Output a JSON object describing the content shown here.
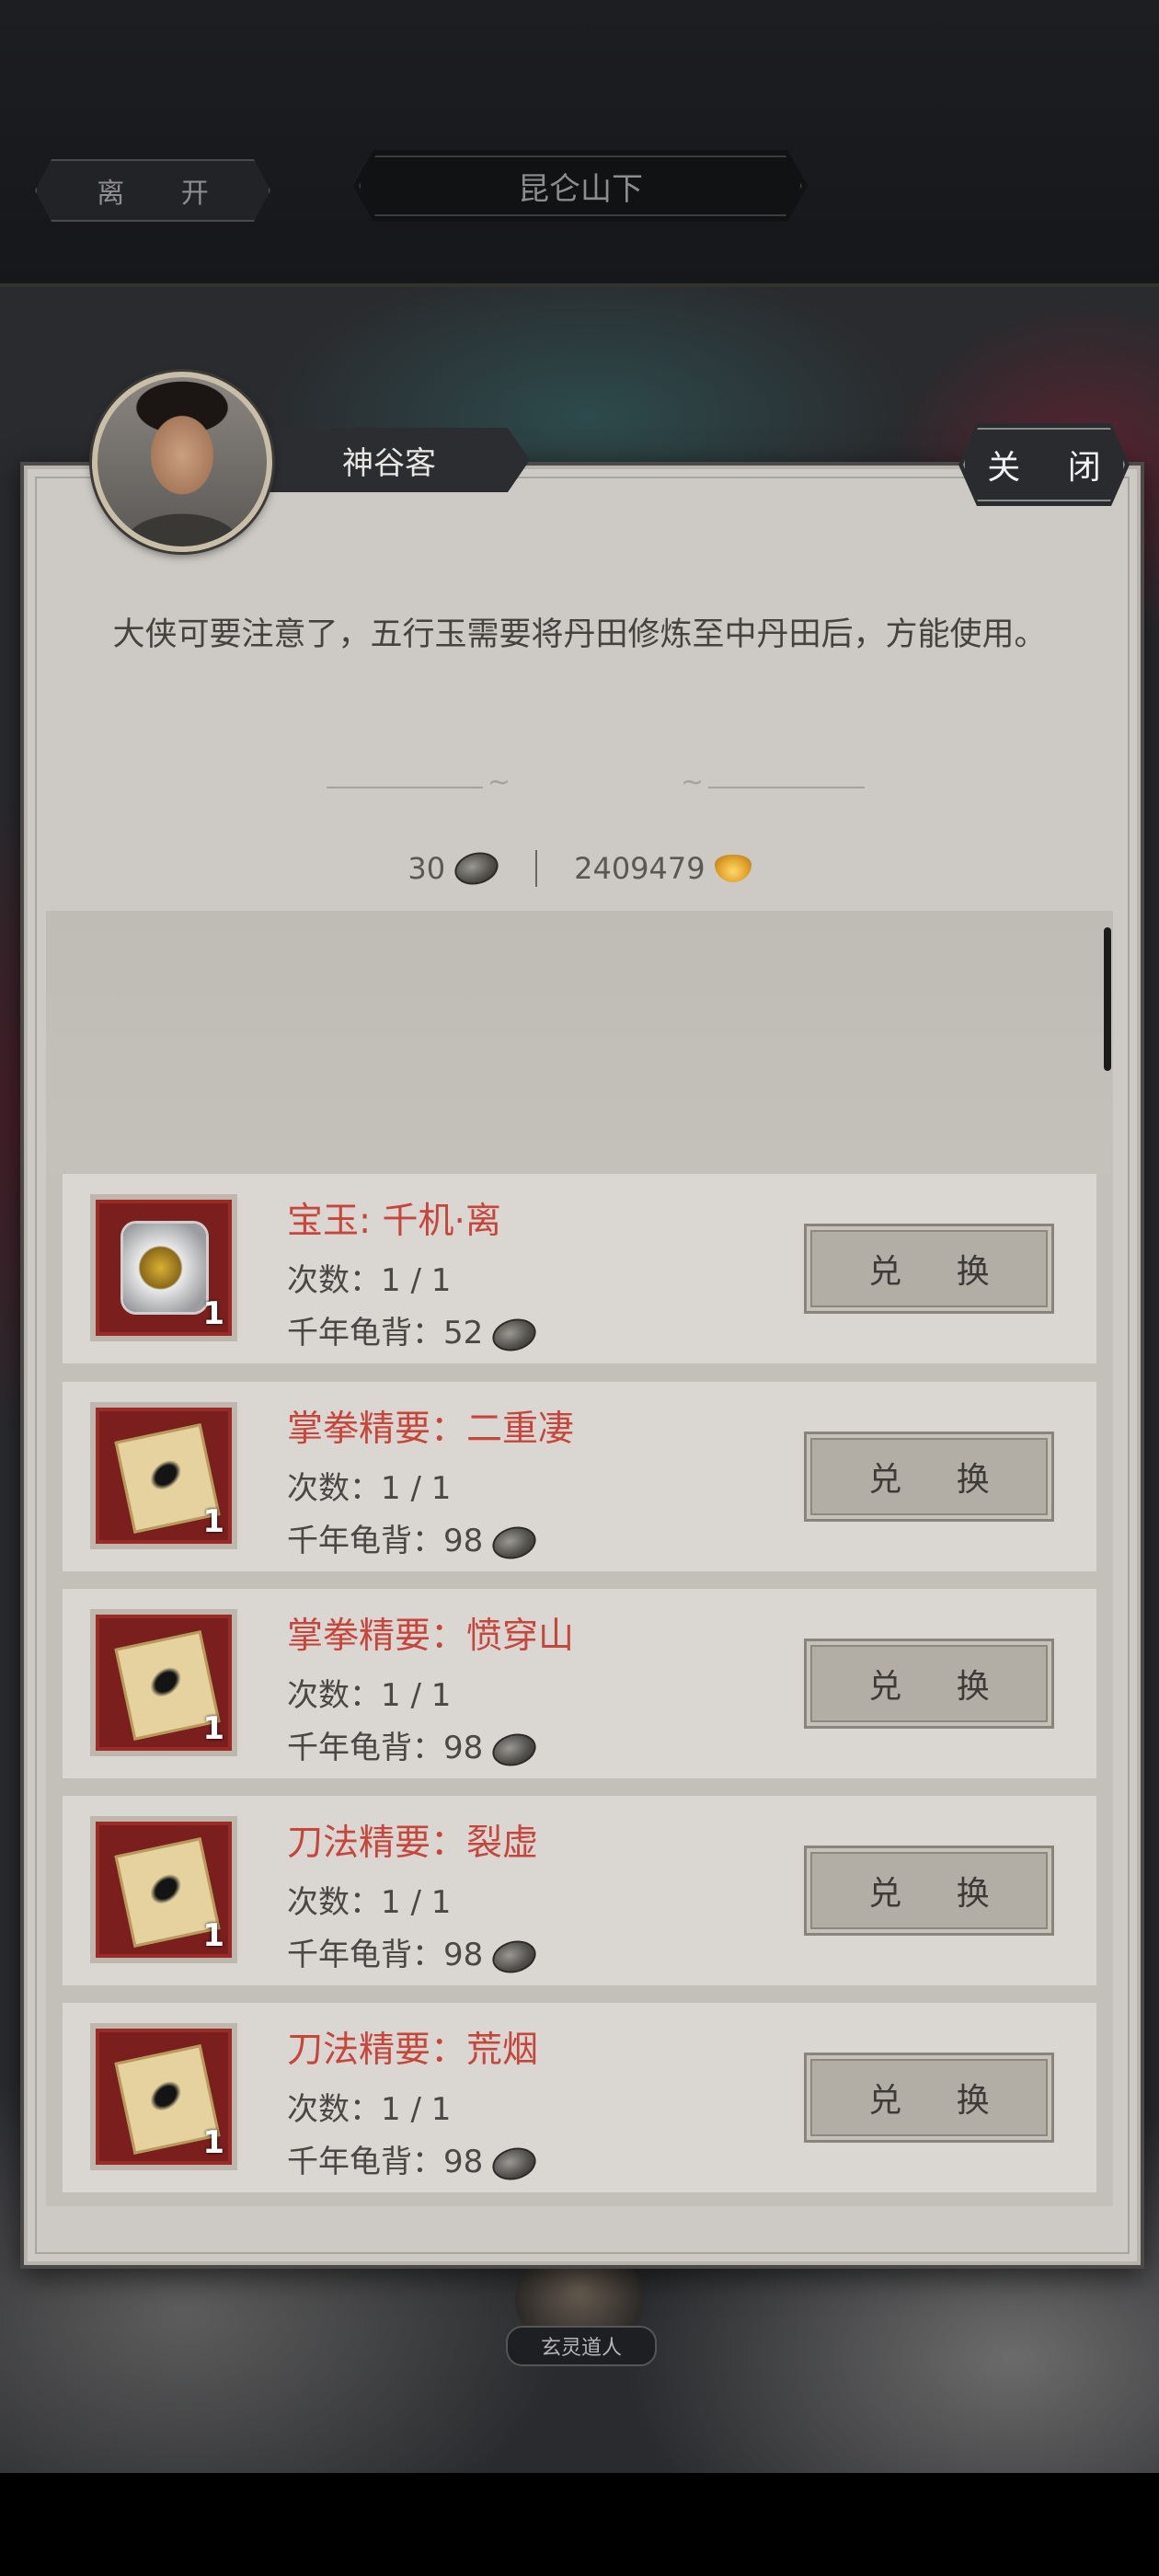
{
  "topbar": {
    "leave_label": "离 开",
    "location": "昆仑山下"
  },
  "dialog": {
    "npc_name": "神谷客",
    "close_label": "关 闭",
    "message": "大侠可要注意了，五行玉需要将丹田修炼至中丹田后，方能使用。",
    "currency": {
      "shell_count": "30",
      "shell_icon": "turtle-shell-icon",
      "gold_count": "2409479",
      "gold_icon": "gold-ingot-icon"
    }
  },
  "items": [
    {
      "name": "宝玉: 千机·离",
      "count": "次数：1 / 1",
      "cost": "千年龟背：52",
      "qty": "1",
      "icon": "jade-orb-icon",
      "button": "兑 换"
    },
    {
      "name": "掌拳精要：二重凄",
      "count": "次数：1 / 1",
      "cost": "千年龟背：98",
      "qty": "1",
      "icon": "manual-book-icon",
      "button": "兑 换"
    },
    {
      "name": "掌拳精要：愤穿山",
      "count": "次数：1 / 1",
      "cost": "千年龟背：98",
      "qty": "1",
      "icon": "manual-book-icon",
      "button": "兑 换"
    },
    {
      "name": "刀法精要：裂虚",
      "count": "次数：1 / 1",
      "cost": "千年龟背：98",
      "qty": "1",
      "icon": "manual-book-icon",
      "button": "兑 换"
    },
    {
      "name": "刀法精要：荒烟",
      "count": "次数：1 / 1",
      "cost": "千年龟背：98",
      "qty": "1",
      "icon": "manual-book-icon",
      "button": "兑 换"
    }
  ],
  "background_npc": {
    "name": "玄灵道人"
  },
  "colors": {
    "item_name": "#c7463c",
    "panel": "#cdc9c4",
    "topbar": "#1d1e22"
  }
}
